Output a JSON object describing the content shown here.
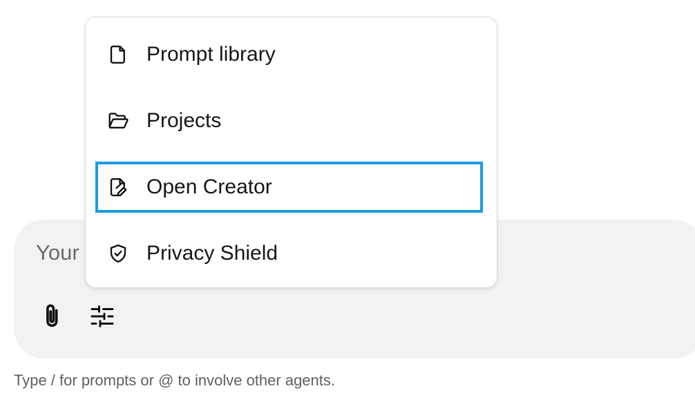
{
  "composer": {
    "placeholder": "Your",
    "attach_icon": "paperclip-icon",
    "settings_icon": "sliders-icon"
  },
  "hint": "Type / for prompts or @ to involve other agents.",
  "menu": {
    "items": [
      {
        "label": "Prompt library",
        "icon": "document-icon"
      },
      {
        "label": "Projects",
        "icon": "folder-open-icon"
      },
      {
        "label": "Open Creator",
        "icon": "document-edit-icon",
        "focused": true
      },
      {
        "label": "Privacy Shield",
        "icon": "shield-check-icon"
      }
    ]
  },
  "colors": {
    "focus_ring": "#1c9be6",
    "composer_bg": "#f2f2f2",
    "text": "#161616",
    "muted": "#6b6b6b"
  }
}
